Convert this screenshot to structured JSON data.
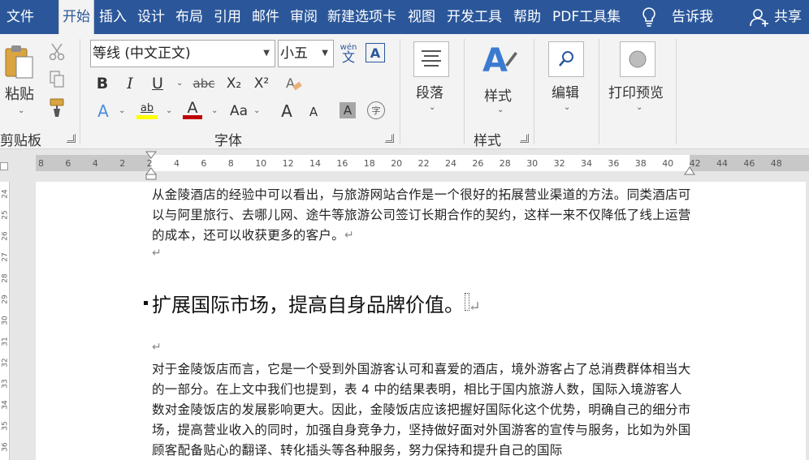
{
  "tabs": [
    {
      "label": "文件",
      "active": false
    },
    {
      "label": "开始",
      "active": true
    },
    {
      "label": "插入",
      "active": false
    },
    {
      "label": "设计",
      "active": false
    },
    {
      "label": "布局",
      "active": false
    },
    {
      "label": "引用",
      "active": false
    },
    {
      "label": "邮件",
      "active": false
    },
    {
      "label": "审阅",
      "active": false
    },
    {
      "label": "新建选项卡",
      "active": false
    },
    {
      "label": "视图",
      "active": false
    },
    {
      "label": "开发工具",
      "active": false
    },
    {
      "label": "帮助",
      "active": false
    },
    {
      "label": "PDF工具集",
      "active": false
    }
  ],
  "tellme": "告诉我",
  "share": "共享",
  "clipboard": {
    "paste_label": "粘贴",
    "group_label": "剪贴板"
  },
  "font": {
    "group_label": "字体",
    "font_name": "等线 (中文正文)",
    "font_size": "小五",
    "phonetic_top": "wén",
    "phonetic_bottom": "文",
    "border_char": "A",
    "bold": "B",
    "italic": "I",
    "underline": "U",
    "strike": "abc",
    "subscript": "X₂",
    "superscript": "X²",
    "text_effect": "A",
    "highlight": "ab",
    "font_color": "A",
    "change_case": "Aa",
    "grow": "A",
    "shrink": "A",
    "shading": "A",
    "enclose": "字"
  },
  "paragraph": {
    "label": "段落"
  },
  "styles": {
    "label": "样式",
    "group_label": "样式"
  },
  "editing": {
    "label": "编辑"
  },
  "print_preview": {
    "label": "打印预览"
  },
  "ruler_ticks": [
    "8",
    "6",
    "4",
    "2",
    "2",
    "4",
    "6",
    "8",
    "10",
    "12",
    "14",
    "16",
    "18",
    "20",
    "22",
    "24",
    "26",
    "28",
    "30",
    "32",
    "34",
    "36",
    "38",
    "40",
    "42",
    "44",
    "46",
    "48"
  ],
  "vruler_ticks": [
    "24",
    "25",
    "26",
    "27",
    "28",
    "29",
    "30",
    "31",
    "32",
    "33",
    "34",
    "35",
    "36"
  ],
  "document": {
    "para1": "从金陵酒店的经验中可以看出，与旅游网站合作是一个很好的拓展营业渠道的方法。同类酒店可以与阿里旅行、去哪儿网、途牛等旅游公司签订长期合作的契约，这样一来不仅降低了线上运营的成本，还可以收获更多的客户。",
    "heading": "扩展国际市场，提高自身品牌价值。",
    "para2": "对于金陵饭店而言，它是一个受到外国游客认可和喜爱的酒店，境外游客占了总消费群体相当大的一部分。在上文中我们也提到，表 4 中的结果表明，相比于国内旅游人数，国际入境游客人数对金陵饭店的发展影响更大。因此，金陵饭店应该把握好国际化这个优势，明确自己的细分市场，提高营业收入的同时，加强自身竞争力，坚持做好面对外国游客的宣传与服务，比如为外国顾客配备贴心的翻译、转化插头等各种服务，努力保持和提升自己的国际"
  },
  "colors": {
    "tab_bar": "#2b579a",
    "highlight": "#ffff00",
    "font_color": "#c00000"
  }
}
